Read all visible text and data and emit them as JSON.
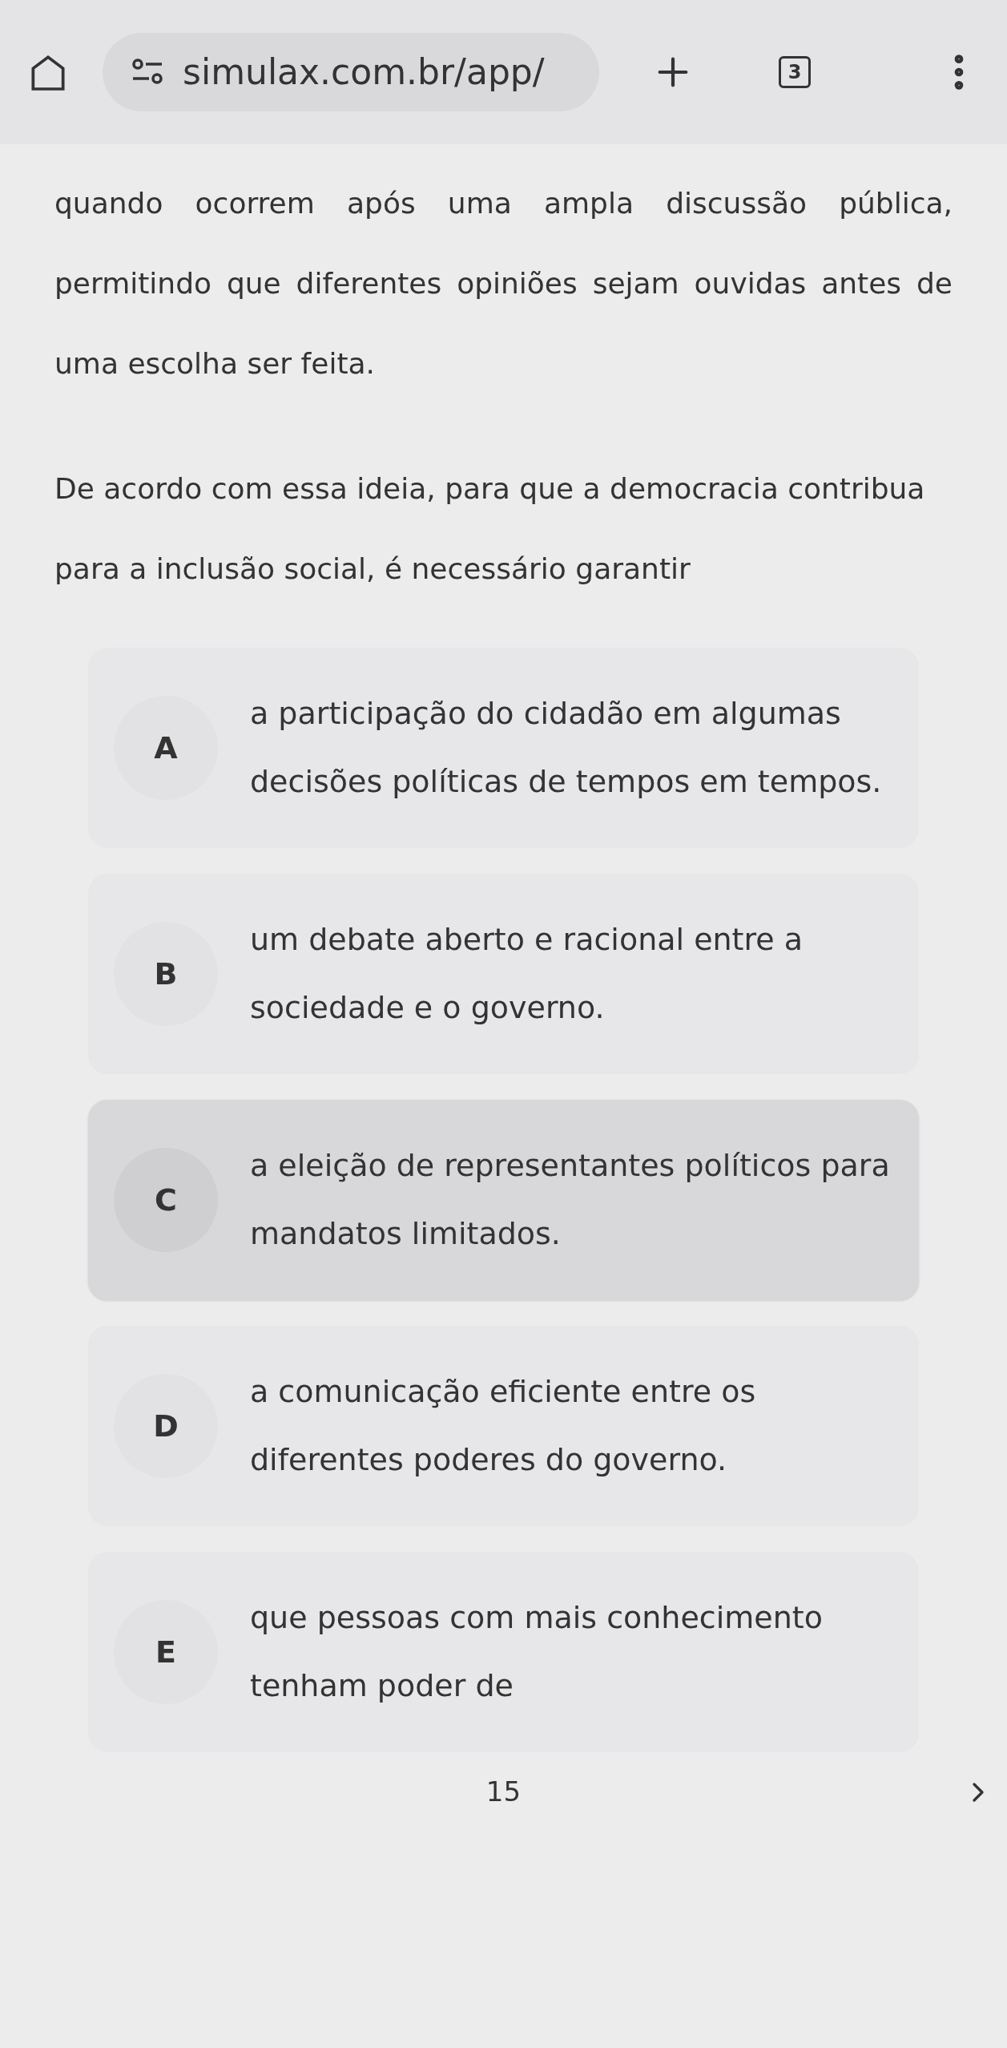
{
  "browser": {
    "url": "simulax.com.br/app/",
    "tab_count": "3"
  },
  "passage": "quando ocorrem após uma ampla discussão pública, permitindo que diferentes opiniões sejam ouvidas antes de uma escolha ser feita.",
  "question": "De acordo com essa ideia, para que a democracia contribua para a inclusão social, é necessário garantir",
  "options": [
    {
      "letter": "A",
      "text": "a participação do cidadão em algumas decisões políticas de tempos em tempos.",
      "selected": false
    },
    {
      "letter": "B",
      "text": "um debate aberto e racional entre a sociedade e o governo.",
      "selected": false
    },
    {
      "letter": "C",
      "text": "a eleição de representantes políticos para mandatos limitados.",
      "selected": true
    },
    {
      "letter": "D",
      "text": "a comunicação eficiente entre os diferentes poderes do governo.",
      "selected": false
    },
    {
      "letter": "E",
      "text": "que pessoas com mais conhecimento tenham poder de",
      "selected": false
    }
  ],
  "footer": {
    "label": "15"
  }
}
